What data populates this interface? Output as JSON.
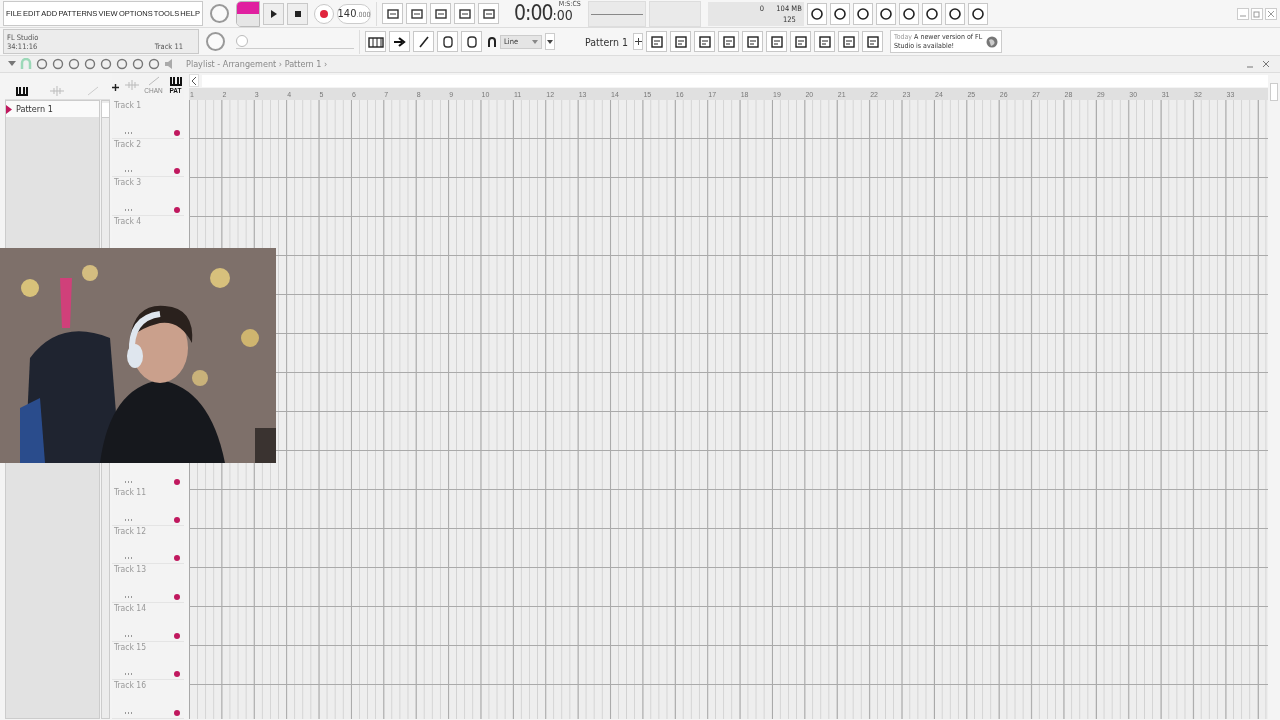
{
  "menu": [
    "FILE",
    "EDIT",
    "ADD",
    "PATTERNS",
    "VIEW",
    "OPTIONS",
    "TOOLS",
    "HELP"
  ],
  "transport": {
    "pattern_mode": true,
    "tempo": "140",
    "tempo_fraction": ".000"
  },
  "time": {
    "value": "0:00",
    "centis": ":00",
    "unit": "M:S:CS"
  },
  "monitor": {
    "cpu": "0",
    "memory": "104 MB",
    "polyphony": "125"
  },
  "master_pitch": {
    "level": 0
  },
  "hint": {
    "title": "FL Studio",
    "time": "34:11:16",
    "target": "Track 11"
  },
  "snap": {
    "value": "Line"
  },
  "pattern_selector": {
    "value": "Pattern 1"
  },
  "news": {
    "date": "Today",
    "message": "A newer version of FL Studio is available!"
  },
  "playlist": {
    "title": "Playlist - Arrangement ›",
    "pattern": "Pattern 1 ›",
    "patterns": [
      {
        "name": "Pattern 1",
        "selected": true
      }
    ],
    "filters": [
      {
        "kind": "audio",
        "selected": false
      },
      {
        "kind": "automation",
        "label": "CHAN",
        "selected": false
      },
      {
        "kind": "pattern",
        "label": "PAT",
        "selected": true
      }
    ],
    "bars": [
      "1",
      "2",
      "3",
      "4",
      "5",
      "6",
      "7",
      "8",
      "9",
      "10",
      "11",
      "12",
      "13",
      "14",
      "15",
      "16",
      "17",
      "18",
      "19",
      "20",
      "21",
      "22",
      "23",
      "24",
      "25",
      "26",
      "27",
      "28",
      "29",
      "30",
      "31",
      "32",
      "33"
    ],
    "tracks_top": [
      "Track 1",
      "Track 2",
      "Track 3",
      "Track 4"
    ],
    "tracks_bottom": [
      "Track 11",
      "Track 12",
      "Track 13",
      "Track 14",
      "Track 15",
      "Track 16"
    ]
  }
}
